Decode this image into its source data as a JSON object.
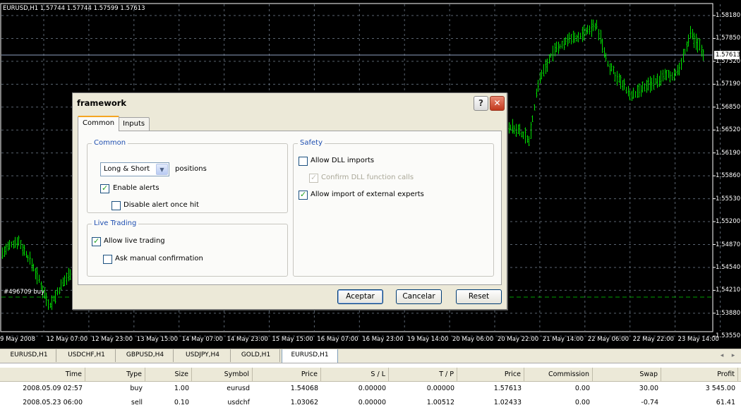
{
  "chart": {
    "title": "EURUSD,H1  1.57744 1.57744 1.57599 1.57613",
    "current_price": "1.57613",
    "order_label": "#496709 buy",
    "y_ticks": [
      "1.58180",
      "1.57850",
      "1.57520",
      "1.57190",
      "1.56850",
      "1.56520",
      "1.56190",
      "1.55860",
      "1.55530",
      "1.55200",
      "1.54870",
      "1.54540",
      "1.54210",
      "1.53880",
      "1.53550"
    ],
    "x_ticks": [
      "9 May 2008",
      "12 May 07:00",
      "12 May 23:00",
      "13 May 15:00",
      "14 May 07:00",
      "14 May 23:00",
      "15 May 15:00",
      "16 May 07:00",
      "16 May 23:00",
      "19 May 14:00",
      "20 May 06:00",
      "20 May 22:00",
      "21 May 14:00",
      "22 May 06:00",
      "22 May 22:00",
      "23 May 14:00"
    ],
    "colors": {
      "background": "#000000",
      "bars": "#00e000",
      "grid": "#5a6470"
    }
  },
  "symbol_tabs": [
    {
      "label": "EURUSD,H1",
      "active": false
    },
    {
      "label": "USDCHF,H1",
      "active": false
    },
    {
      "label": "GBPUSD,H4",
      "active": false
    },
    {
      "label": "USDJPY,H4",
      "active": false
    },
    {
      "label": "GOLD,H1",
      "active": false
    },
    {
      "label": "EURUSD,H1",
      "active": true
    }
  ],
  "tab_scroll": {
    "left": "◂",
    "right": "▸"
  },
  "terminal": {
    "headers": [
      "Time",
      "Type",
      "Size",
      "Symbol",
      "Price",
      "S / L",
      "T / P",
      "Price",
      "Commission",
      "Swap",
      "Profit"
    ],
    "rows": [
      [
        "2008.05.09 02:57",
        "buy",
        "1.00",
        "eurusd",
        "1.54068",
        "0.00000",
        "0.00000",
        "1.57613",
        "0.00",
        "30.00",
        "3 545.00"
      ],
      [
        "2008.05.23 06:00",
        "sell",
        "0.10",
        "usdchf",
        "1.03062",
        "0.00000",
        "1.00512",
        "1.02433",
        "0.00",
        "-0.74",
        "61.41"
      ]
    ]
  },
  "dialog": {
    "title": "framework",
    "help_label": "?",
    "close_label": "✕",
    "tabs": [
      {
        "label": "Common",
        "active": true
      },
      {
        "label": "Inputs",
        "active": false
      }
    ],
    "common_group": {
      "legend": "Common",
      "positions_value": "Long & Short",
      "positions_label": "positions",
      "combo_arrow": "▼",
      "enable_alerts": {
        "label": "Enable alerts",
        "checked": true
      },
      "disable_alert_once_hit": {
        "label": "Disable alert once hit",
        "checked": false
      }
    },
    "live_group": {
      "legend": "Live Trading",
      "allow_live_trading": {
        "label": "Allow live trading",
        "checked": true
      },
      "ask_manual_confirmation": {
        "label": "Ask manual confirmation",
        "checked": false
      }
    },
    "safety_group": {
      "legend": "Safety",
      "allow_dll_imports": {
        "label": "Allow DLL imports",
        "checked": false
      },
      "confirm_dll_calls": {
        "label": "Confirm DLL function calls",
        "checked": true,
        "disabled": true
      },
      "allow_external_experts": {
        "label": "Allow import of external experts",
        "checked": true
      }
    },
    "buttons": {
      "accept": "Aceptar",
      "cancel": "Cancelar",
      "reset": "Reset"
    }
  }
}
